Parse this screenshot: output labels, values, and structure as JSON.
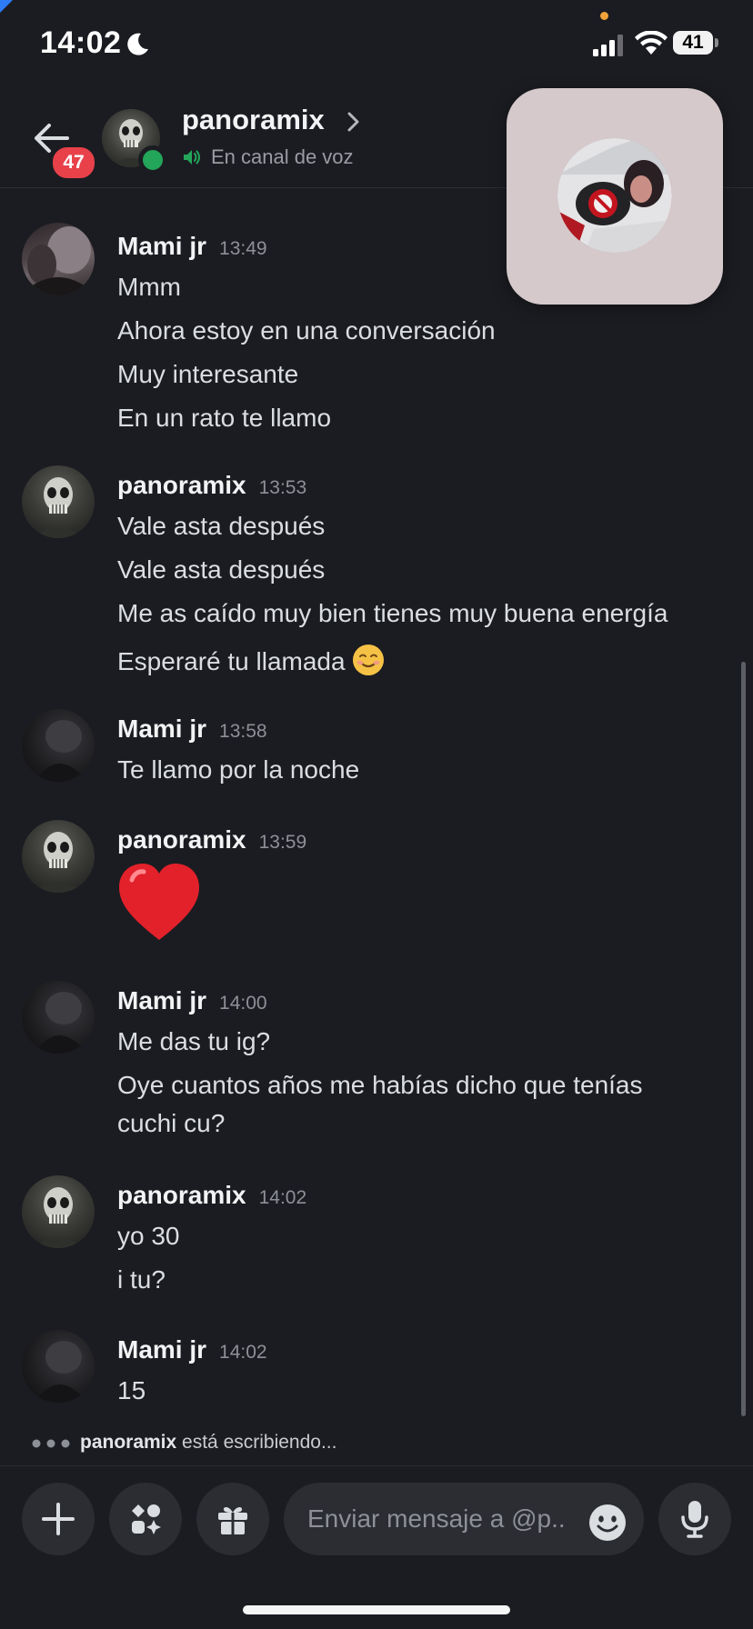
{
  "status_bar": {
    "time": "14:02",
    "battery": "41"
  },
  "header": {
    "unread_count": "47",
    "name": "panoramix",
    "status": "En canal de voz"
  },
  "messages": [
    {
      "author": "Mami jr",
      "time": "13:49",
      "lines": [
        "Mmm",
        "Ahora estoy en una conversación",
        "Muy interesante",
        "En un rato te llamo"
      ]
    },
    {
      "author": "panoramix",
      "time": "13:53",
      "lines": [
        "Vale asta después",
        "Vale asta después",
        "Me as caído muy bien tienes muy buena energía",
        "Esperaré tu llamada"
      ]
    },
    {
      "author": "Mami jr",
      "time": "13:58",
      "lines": [
        "Te llamo por la noche"
      ]
    },
    {
      "author": "panoramix",
      "time": "13:59",
      "lines": []
    },
    {
      "author": "Mami jr",
      "time": "14:00",
      "lines": [
        "Me das tu ig?",
        "Oye cuantos años me habías dicho que tenías",
        "cuchi cu?"
      ]
    },
    {
      "author": "panoramix",
      "time": "14:02",
      "lines": [
        "yo 30",
        "i tu?"
      ]
    },
    {
      "author": "Mami jr",
      "time": "14:02",
      "lines": [
        "15"
      ]
    }
  ],
  "typing": {
    "name": "panoramix",
    "text": " está escribiendo..."
  },
  "composer": {
    "placeholder": "Enviar mensaje a @p.."
  },
  "icons": {
    "back": "arrow-left-icon",
    "voice": "speaker-icon",
    "add": "plus-icon",
    "apps": "apps-icon",
    "gift": "gift-icon",
    "emoji": "emoji-icon",
    "mic": "microphone-icon"
  },
  "colors": {
    "background": "#1b1c21",
    "online": "#23a55a",
    "badge": "#e8414a",
    "overlay": "#d5c9cb"
  }
}
